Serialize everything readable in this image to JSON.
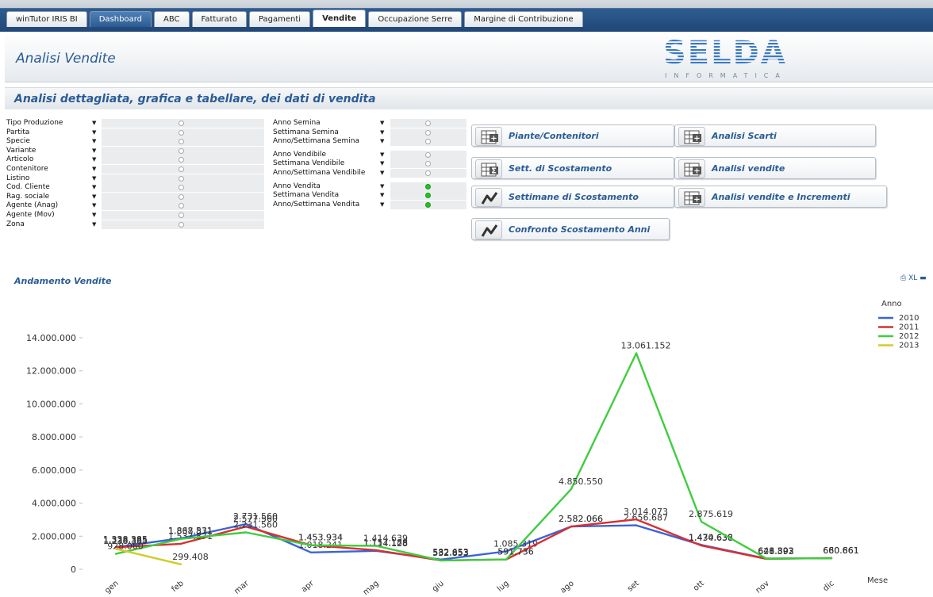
{
  "tabs": [
    {
      "label": "winTutor IRIS BI",
      "state": "normal"
    },
    {
      "label": "Dashboard",
      "state": "active"
    },
    {
      "label": "ABC",
      "state": "normal"
    },
    {
      "label": "Fatturato",
      "state": "normal"
    },
    {
      "label": "Pagamenti",
      "state": "normal"
    },
    {
      "label": "Vendite",
      "state": "current"
    },
    {
      "label": "Occupazione Serre",
      "state": "normal"
    },
    {
      "label": "Margine di Contribuzione",
      "state": "normal"
    }
  ],
  "page": {
    "title": "Analisi Vendite",
    "subtitle": "Analisi dettagliata, grafica e tabellare, dei dati di vendita"
  },
  "logo": {
    "name": "SELDA",
    "tagline": "INFORMATICA"
  },
  "filters_left": [
    {
      "label": "Tipo Produzione",
      "on": false
    },
    {
      "label": "Partita",
      "on": false
    },
    {
      "label": "Specie",
      "on": false
    },
    {
      "label": "Variante",
      "on": false
    },
    {
      "label": "Articolo",
      "on": false
    },
    {
      "label": "Contenitore",
      "on": false
    },
    {
      "label": "Listino",
      "on": false
    },
    {
      "label": "Cod. Cliente",
      "on": false
    },
    {
      "label": "Rag. sociale",
      "on": false
    },
    {
      "label": "Agente (Anag)",
      "on": false
    },
    {
      "label": "Agente (Mov)",
      "on": false
    },
    {
      "label": "Zona",
      "on": false
    }
  ],
  "filters_mid": [
    {
      "label": "Anno Semina",
      "on": false
    },
    {
      "label": "Settimana Semina",
      "on": false
    },
    {
      "label": "Anno/Settimana Semina",
      "on": false
    },
    {
      "label": "Anno Vendibile",
      "on": false
    },
    {
      "label": "Settimana Vendibile",
      "on": false
    },
    {
      "label": "Anno/Settimana Vendibile",
      "on": false
    },
    {
      "label": "Anno Vendita",
      "on": true
    },
    {
      "label": "Settimana Vendita",
      "on": true
    },
    {
      "label": "Anno/Settimana Vendita",
      "on": true
    }
  ],
  "buttons": [
    {
      "label": "Piante/Contenitori",
      "icon": "table-plus-icon"
    },
    {
      "label": "Sett. di Scostamento",
      "icon": "table-sigma-icon"
    },
    {
      "label": "Settimane di Scostamento",
      "icon": "line-chart-icon"
    },
    {
      "label": "Confronto Scostamento Anni",
      "icon": "line-chart-icon"
    },
    {
      "label": "Analisi Scarti",
      "icon": "table-plus-icon"
    },
    {
      "label": "Analisi vendite",
      "icon": "table-plus-icon"
    },
    {
      "label": "Analisi vendite e Incrementi",
      "icon": "table-plus-icon"
    }
  ],
  "chart_title": "Andamento Vendite",
  "chart_tools": "XL",
  "chart_data": {
    "type": "line",
    "xlabel": "Mese",
    "legend_title": "Anno",
    "legend_position": "top-right",
    "x": [
      "gen",
      "feb",
      "mar",
      "apr",
      "mag",
      "giu",
      "lug",
      "ago",
      "set",
      "ott",
      "nov",
      "dic"
    ],
    "yticks": [
      "0",
      "2.000.000",
      "4.000.000",
      "6.000.000",
      "8.000.000",
      "10.000.000",
      "12.000.000",
      "14.000.000"
    ],
    "ylim": [
      0,
      14000000
    ],
    "series": [
      {
        "name": "2010",
        "color": "#3b63d8",
        "values": [
          1338385,
          1868531,
          2731560,
          1018241,
          1114128,
          582653,
          1085319,
          2582066,
          2656687,
          1470638,
          646393,
          660661
        ],
        "labels": [
          "1.338.385",
          "1.868.531",
          "2.731.560",
          "1.018.241",
          "1.114.128",
          "582.653",
          "1.085.319",
          "2.582.066",
          "2.656.687",
          "1.470.638",
          "646.393",
          "660.661"
        ]
      },
      {
        "name": "2011",
        "color": "#d93030",
        "values": [
          1328385,
          1537871,
          2577560,
          1453934,
          1157188,
          532853,
          591736,
          2582066,
          3014073,
          1434638,
          628393,
          680861
        ],
        "labels": [
          "1.328.385",
          "1.537.871",
          "2.577.560",
          "1.453.934",
          "1.157.188",
          "532.853",
          "591.736",
          "2.582.066",
          "3.014.073",
          "1.434.638",
          "628.393",
          "680.861"
        ]
      },
      {
        "name": "2012",
        "color": "#3fcd3f",
        "values": [
          928060,
          1837871,
          2231560,
          1453934,
          1414639,
          532853,
          591736,
          4850550,
          13061152,
          2875619,
          641802,
          660661
        ],
        "labels": [
          "928.060",
          "1.837.871",
          "2.231.560",
          "1.453.934",
          "1.414.639",
          "532.853",
          "591.736",
          "4.850.550",
          "13.061.152",
          "2.875.619",
          "641.802",
          "660.661"
        ]
      },
      {
        "name": "2013",
        "color": "#cfcc2a",
        "values": [
          1238385,
          299408
        ],
        "labels": [
          "1.238.385",
          "299.408"
        ]
      }
    ]
  }
}
